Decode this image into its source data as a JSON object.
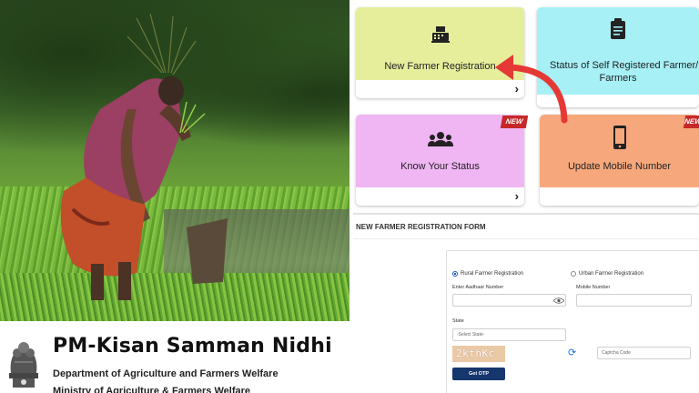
{
  "brand": {
    "title": "PM-Kisan Samman Nidhi",
    "department": "Department of Agriculture and Farmers Welfare",
    "ministry": "Ministry of Agriculture & Farmers Welfare"
  },
  "tiles": [
    {
      "label": "New Farmer Registration",
      "icon": "cash-register-icon",
      "color": "#e6ee9c"
    },
    {
      "label_line1": "Status of Self Registered Farmer/ CSC",
      "label_line2": "Farmers",
      "icon": "clipboard-icon",
      "color": "#a6f0f6"
    },
    {
      "label": "Know Your Status",
      "icon": "users-icon",
      "color": "#f0b5f3",
      "badge": "NEW"
    },
    {
      "label": "Update Mobile Number",
      "icon": "mobile-phone-icon",
      "color": "#f6a87c",
      "badge": "NEW"
    }
  ],
  "tile_chevron": "›",
  "form": {
    "title": "NEW FARMER REGISTRATION FORM",
    "radio_rural": "Rural Farmer Registration",
    "radio_urban": "Urban Farmer Registration",
    "aadhaar_label": "Enter Aadhaar Number",
    "mobile_label": "Mobile Number",
    "state_label": "State",
    "state_placeholder": "-Select State-",
    "captcha_text": "2kthKc",
    "captcha_placeholder": "Captcha Code",
    "otp_button": "Get OTP"
  },
  "colors": {
    "arrow": "#e53935",
    "otp_button": "#16366e",
    "badge": "#c62828"
  }
}
